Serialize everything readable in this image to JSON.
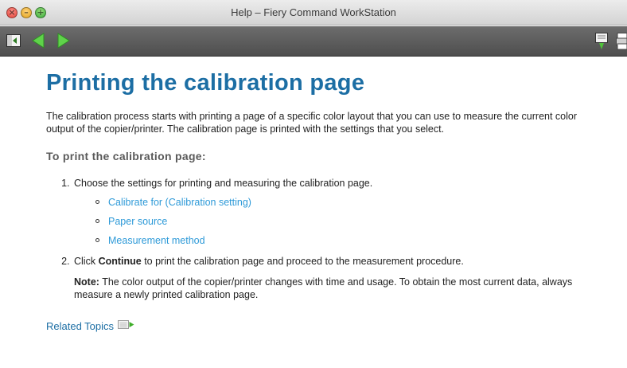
{
  "window": {
    "title": "Help – Fiery Command WorkStation",
    "buttons": {
      "close": "×",
      "minimize": "–",
      "zoom": "+"
    }
  },
  "toolbar": {
    "items": [
      "contents-toggle-icon",
      "back-arrow-icon",
      "forward-arrow-icon",
      "comment-icon",
      "print-icon"
    ]
  },
  "article": {
    "title": "Printing the calibration page",
    "intro": "The calibration process starts with printing a page of a specific color layout that you can use to measure the current color output of the copier/printer. The calibration page is printed with the settings that you select.",
    "procedure_heading": "To print the calibration page:",
    "step1": "Choose the settings for printing and measuring the calibration page.",
    "step1_links": [
      "Calibrate for (Calibration setting)",
      "Paper source",
      "Measurement method"
    ],
    "step2_prefix": "Click ",
    "step2_bold": "Continue",
    "step2_suffix": " to print the calibration page and proceed to the measurement procedure.",
    "note_label": "Note:",
    "note_text": " The color output of the copier/printer changes with time and usage. To obtain the most current data, always measure a newly printed calibration page.",
    "related_topics": "Related Topics"
  },
  "colors": {
    "title_blue": "#1c6ea4",
    "link_blue": "#2e9ad8",
    "toolbar_gray": "#5a5a5a",
    "arrow_green": "#5fd24a"
  }
}
